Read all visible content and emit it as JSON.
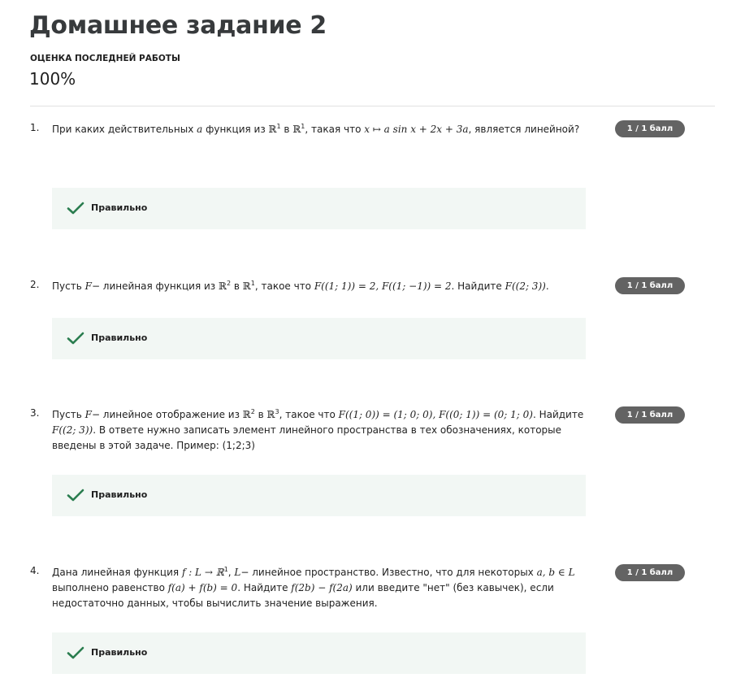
{
  "page": {
    "title": "Домашнее задание 2",
    "grade_label": "ОЦЕНКА ПОСЛЕДНЕЙ РАБОТЫ",
    "grade_value": "100%"
  },
  "questions": [
    {
      "number": "1.",
      "badge": "1 / 1 балл",
      "result": "Правильно",
      "t1": "При каких действительных ",
      "m1": "a",
      "t2": " функция из ",
      "m2": "ℝ",
      "s2": "1",
      "t3": " в ",
      "m3": "ℝ",
      "s3": "1",
      "t4": ", такая что ",
      "m4": "x ↦ a sin x + 2x + 3a",
      "t5": ", является линейной?"
    },
    {
      "number": "2.",
      "badge": "1 / 1 балл",
      "result": "Правильно",
      "t1": "Пусть ",
      "m1": "F",
      "t2": "− линейная функция из ",
      "m2": "ℝ",
      "s2": "2",
      "t3": " в ",
      "m3": "ℝ",
      "s3": "1",
      "t4": ", такое что ",
      "m4": "F((1; 1)) = 2, F((1; −1)) = 2",
      "t5": ". Найдите ",
      "m5": "F((2; 3))",
      "t6": "."
    },
    {
      "number": "3.",
      "badge": "1 / 1 балл",
      "result": "Правильно",
      "t1": "Пусть ",
      "m1": "F",
      "t2": "− линейное отображение из ",
      "m2": "ℝ",
      "s2": "2",
      "t3": " в ",
      "m3": "ℝ",
      "s3": "3",
      "t4": ", такое что ",
      "m4": "F((1; 0)) = (1; 0; 0), F((0; 1)) = (0; 1; 0)",
      "t5": ". Найдите ",
      "m5": "F((2; 3))",
      "t6": ". В ответе нужно записать элемент линейного пространства в тех обозначениях, которые введены в этой задаче. Пример: (1;2;3)"
    },
    {
      "number": "4.",
      "badge": "1 / 1 балл",
      "result": "Правильно",
      "t1": "Дана линейная функция ",
      "m1": "f : L → ℝ",
      "s1": "1",
      "t2": ", ",
      "m2": "L",
      "t3": "− линейное пространство. Известно, что для некоторых ",
      "m3": "a, b ∈ L",
      "t4": " выполнено равенство ",
      "m4": "f(a) + f(b) = 0",
      "t5": ". Найдите ",
      "m5": "f(2b) − f(2a)",
      "t6": " или введите \"нет\" (без кавычек), если недостаточно данных, чтобы вычислить значение выражения."
    }
  ],
  "colors": {
    "badge_bg": "#636363",
    "result_bg": "#f2f7f4",
    "check": "#2a7d4f"
  },
  "icons": {
    "result": "checkmark-icon"
  }
}
